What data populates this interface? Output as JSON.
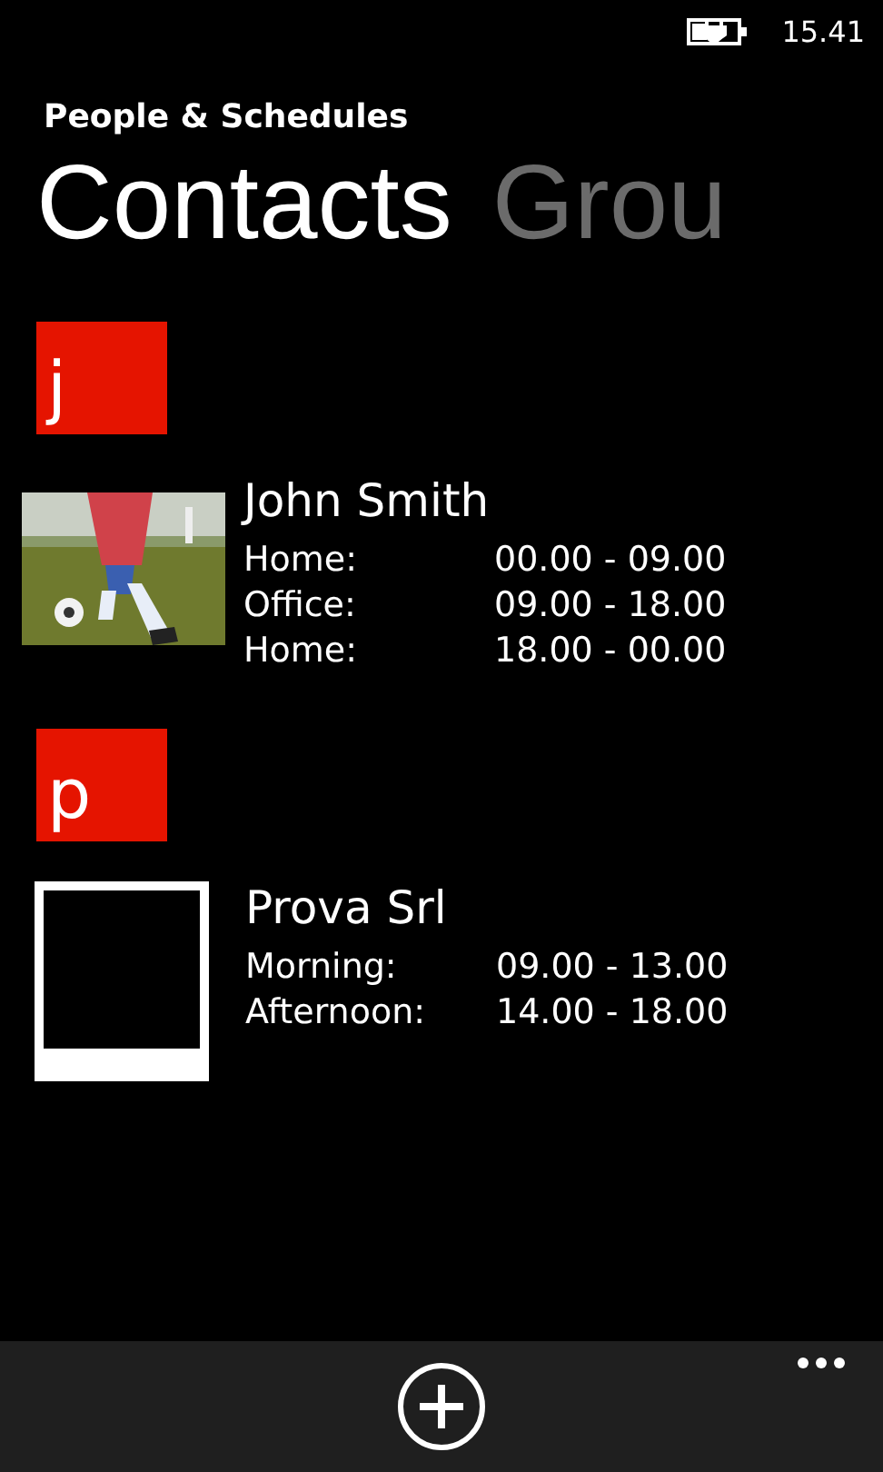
{
  "status_bar": {
    "time": "15.41"
  },
  "app_title": "People & Schedules",
  "pivot": [
    {
      "label": "Contacts",
      "selected": true
    },
    {
      "label": "Grou",
      "selected": false
    }
  ],
  "groups": [
    {
      "letter": "j",
      "contacts": [
        {
          "name": "John Smith",
          "kind": "picture",
          "schedule": [
            {
              "label": "Home:",
              "time": "00.00 - 09.00"
            },
            {
              "label": "Office:",
              "time": "09.00 - 18.00"
            },
            {
              "label": "Home:",
              "time": "18.00 - 00.00"
            }
          ]
        }
      ]
    },
    {
      "letter": "p",
      "contacts": [
        {
          "name": "Prova Srl",
          "kind": "empty",
          "schedule": [
            {
              "label": "Morning:",
              "time": "09.00 - 13.00"
            },
            {
              "label": "Afternoon:",
              "time": "14.00 - 18.00"
            }
          ]
        }
      ]
    }
  ],
  "app_bar": {
    "buttons": [
      {
        "kind": "add"
      },
      {
        "kind": "more"
      }
    ]
  }
}
